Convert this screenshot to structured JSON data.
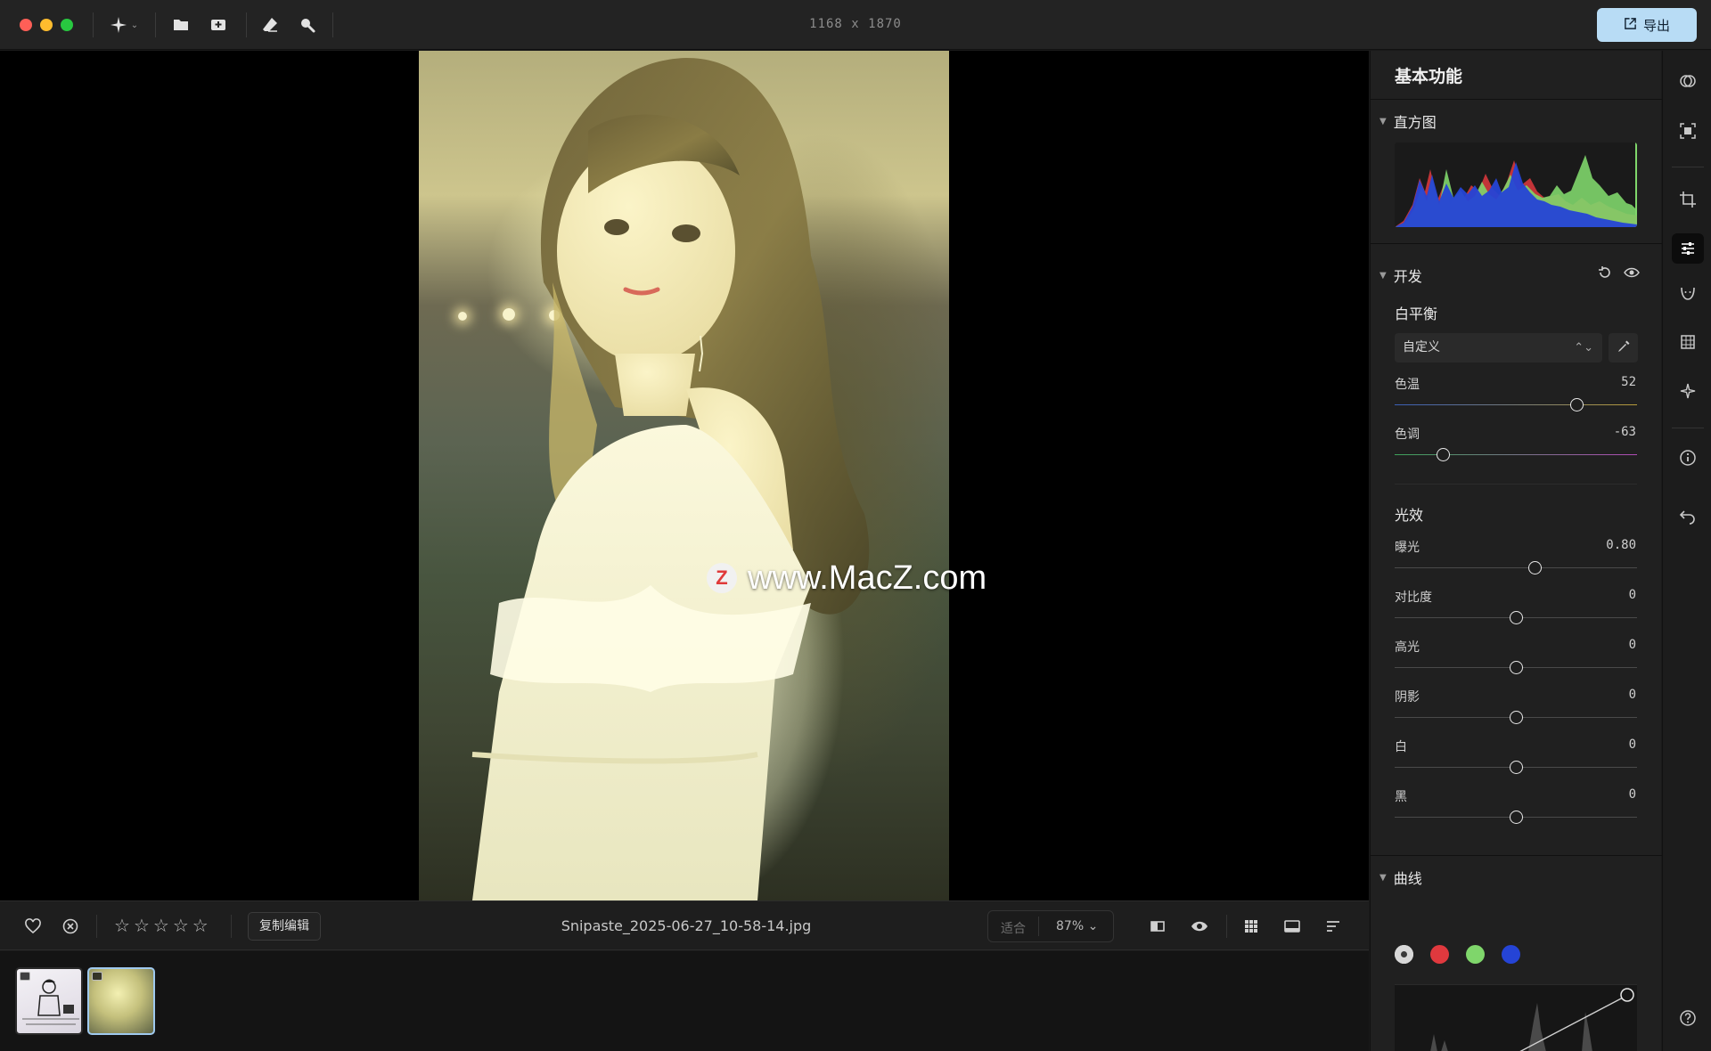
{
  "window": {
    "document_size": "1168 x 1870"
  },
  "toolbar": {
    "export_label": "导出"
  },
  "canvas": {
    "watermark_logo": "Z",
    "watermark_text": "www.MacZ.com"
  },
  "bottom_bar": {
    "copy_edit_label": "复制编辑",
    "filename": "Snipaste_2025-06-27_10-58-14.jpg",
    "zoom_fit_label": "适合",
    "zoom_value": "87% ⌄",
    "rating": 0,
    "rating_max": 5
  },
  "panel": {
    "title": "基本功能",
    "histogram_label": "直方图",
    "develop_label": "开发",
    "white_balance_label": "白平衡",
    "white_balance_value": "自定义",
    "temperature": {
      "label": "色温",
      "value": "52",
      "position": 0.75
    },
    "tint": {
      "label": "色调",
      "value": "-63",
      "position": 0.2
    },
    "light_label": "光效",
    "light_sliders": [
      {
        "label": "曝光",
        "value": "0.80",
        "position": 0.58
      },
      {
        "label": "对比度",
        "value": "0",
        "position": 0.5
      },
      {
        "label": "高光",
        "value": "0",
        "position": 0.5
      },
      {
        "label": "阴影",
        "value": "0",
        "position": 0.5
      },
      {
        "label": "白",
        "value": "0",
        "position": 0.5
      },
      {
        "label": "黑",
        "value": "0",
        "position": 0.5
      }
    ],
    "curves_label": "曲线",
    "curve_channels": [
      "all",
      "red",
      "green",
      "blue"
    ]
  },
  "colors": {
    "accent": "#b8dcf5",
    "red_channel": "#e0393e",
    "green_channel": "#7fd66b",
    "blue_channel": "#2544d6"
  },
  "filmstrip": {
    "thumbnail_count": 2,
    "selected_index": 1
  }
}
